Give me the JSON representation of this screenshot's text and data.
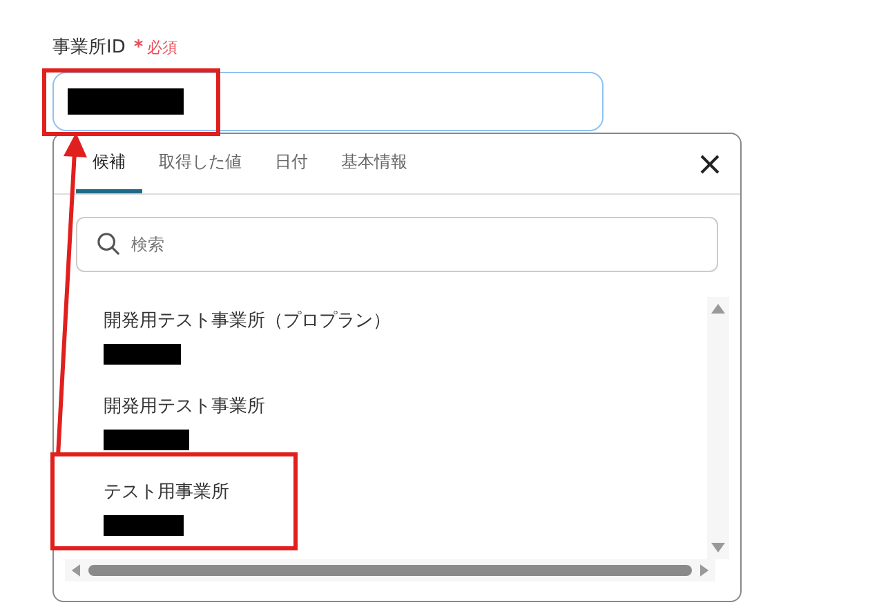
{
  "field": {
    "label": "事業所ID",
    "required_mark": "*",
    "required_text": "必須"
  },
  "dropdown": {
    "tabs": [
      {
        "label": "候補",
        "selected": true
      },
      {
        "label": "取得した値",
        "selected": false
      },
      {
        "label": "日付",
        "selected": false
      },
      {
        "label": "基本情報",
        "selected": false
      }
    ],
    "search": {
      "placeholder": "検索"
    },
    "options": [
      {
        "name": "開発用テスト事業所（プロプラン）"
      },
      {
        "name": "開発用テスト事業所"
      },
      {
        "name": "テスト用事業所"
      }
    ]
  }
}
